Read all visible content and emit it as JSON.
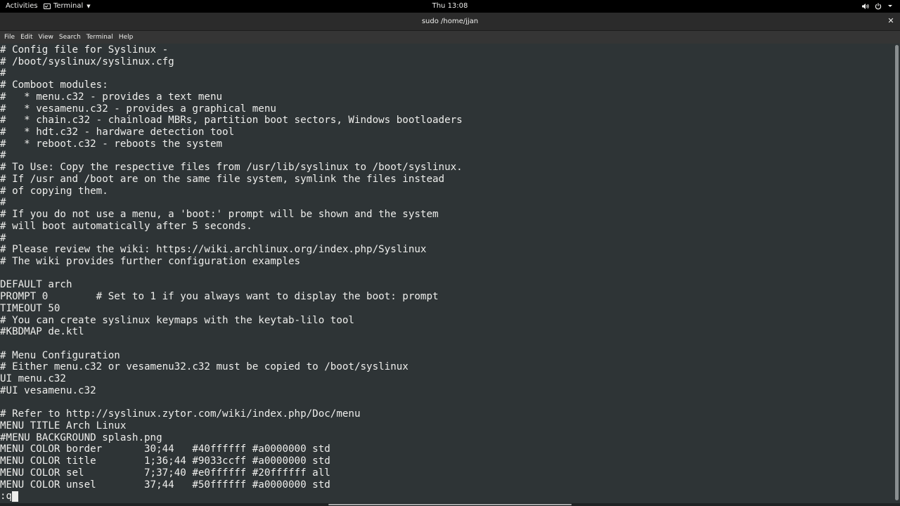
{
  "topbar": {
    "activities": "Activities",
    "app_name": "Terminal",
    "app_icon": "terminal-icon",
    "clock": "Thu 13:08",
    "status_icons": [
      "volume-icon",
      "power-icon",
      "chevron-down-icon"
    ]
  },
  "window": {
    "title": "sudo  /home/jjan",
    "close_label": "✕",
    "menu": [
      "File",
      "Edit",
      "View",
      "Search",
      "Terminal",
      "Help"
    ]
  },
  "terminal": {
    "lines": [
      "# Config file for Syslinux -",
      "# /boot/syslinux/syslinux.cfg",
      "#",
      "# Comboot modules:",
      "#   * menu.c32 - provides a text menu",
      "#   * vesamenu.c32 - provides a graphical menu",
      "#   * chain.c32 - chainload MBRs, partition boot sectors, Windows bootloaders",
      "#   * hdt.c32 - hardware detection tool",
      "#   * reboot.c32 - reboots the system",
      "#",
      "# To Use: Copy the respective files from /usr/lib/syslinux to /boot/syslinux.",
      "# If /usr and /boot are on the same file system, symlink the files instead",
      "# of copying them.",
      "#",
      "# If you do not use a menu, a 'boot:' prompt will be shown and the system",
      "# will boot automatically after 5 seconds.",
      "#",
      "# Please review the wiki: https://wiki.archlinux.org/index.php/Syslinux",
      "# The wiki provides further configuration examples",
      "",
      "DEFAULT arch",
      "PROMPT 0        # Set to 1 if you always want to display the boot: prompt",
      "TIMEOUT 50",
      "# You can create syslinux keymaps with the keytab-lilo tool",
      "#KBDMAP de.ktl",
      "",
      "# Menu Configuration",
      "# Either menu.c32 or vesamenu32.c32 must be copied to /boot/syslinux",
      "UI menu.c32",
      "#UI vesamenu.c32",
      "",
      "# Refer to http://syslinux.zytor.com/wiki/index.php/Doc/menu",
      "MENU TITLE Arch Linux",
      "#MENU BACKGROUND splash.png",
      "MENU COLOR border       30;44   #40ffffff #a0000000 std",
      "MENU COLOR title        1;36;44 #9033ccff #a0000000 std",
      "MENU COLOR sel          7;37;40 #e0ffffff #20ffffff all",
      "MENU COLOR unsel        37;44   #50ffffff #a0000000 std"
    ],
    "command": ":q"
  }
}
